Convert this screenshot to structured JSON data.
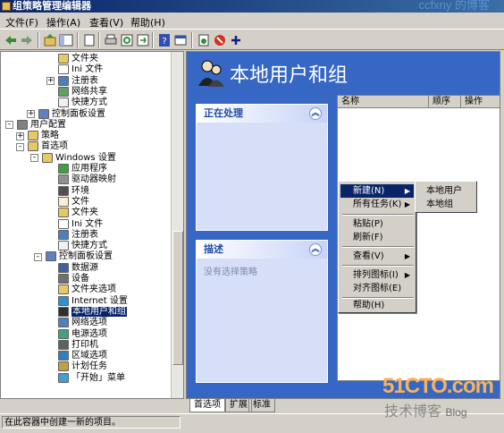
{
  "window": {
    "title": "组策略管理编辑器",
    "watermark_top": "ccfxny 的博客"
  },
  "menubar": {
    "items": [
      "文件(F)",
      "操作(A)",
      "查看(V)",
      "帮助(H)"
    ]
  },
  "toolbar": {
    "icons": [
      "back-icon",
      "forward-icon",
      "up-icon",
      "show-hide-tree-icon",
      "copy-icon",
      "print-icon",
      "refresh-icon",
      "export-icon",
      "help-icon",
      "properties-icon",
      "new-item-icon",
      "stop-icon",
      "add-icon"
    ]
  },
  "tree": {
    "rows": [
      {
        "label": "文件夹",
        "icon": "folder"
      },
      {
        "label": "Ini 文件",
        "icon": "ini"
      },
      {
        "label": "注册表",
        "icon": "registry",
        "expander": "+"
      },
      {
        "label": "网络共享",
        "icon": "share"
      },
      {
        "label": "快捷方式",
        "icon": "shortcut"
      },
      {
        "label": "控制面板设置",
        "icon": "control-panel",
        "expander": "+"
      },
      {
        "label": "用户配置",
        "icon": "user",
        "expander": "-"
      },
      {
        "label": "策略",
        "icon": "folder",
        "expander": "+"
      },
      {
        "label": "首选项",
        "icon": "folder",
        "expander": "-"
      },
      {
        "label": "Windows 设置",
        "icon": "folder",
        "expander": "-"
      },
      {
        "label": "应用程序",
        "icon": "app"
      },
      {
        "label": "驱动器映射",
        "icon": "drive"
      },
      {
        "label": "环境",
        "icon": "env"
      },
      {
        "label": "文件",
        "icon": "file"
      },
      {
        "label": "文件夹",
        "icon": "folder"
      },
      {
        "label": "Ini 文件",
        "icon": "ini"
      },
      {
        "label": "注册表",
        "icon": "registry"
      },
      {
        "label": "快捷方式",
        "icon": "shortcut"
      },
      {
        "label": "控制面板设置",
        "icon": "control-panel",
        "expander": "-"
      },
      {
        "label": "数据源",
        "icon": "datasource"
      },
      {
        "label": "设备",
        "icon": "device"
      },
      {
        "label": "文件夹选项",
        "icon": "folder-options"
      },
      {
        "label": "Internet 设置",
        "icon": "internet"
      },
      {
        "label": "本地用户和组",
        "icon": "users",
        "selected": true
      },
      {
        "label": "网络选项",
        "icon": "network"
      },
      {
        "label": "电源选项",
        "icon": "power"
      },
      {
        "label": "打印机",
        "icon": "printer"
      },
      {
        "label": "区域选项",
        "icon": "region"
      },
      {
        "label": "计划任务",
        "icon": "task"
      },
      {
        "label": "「开始」菜单",
        "icon": "start-menu"
      }
    ]
  },
  "right": {
    "title": "本地用户和组",
    "panel_processing": {
      "heading": "正在处理"
    },
    "panel_description": {
      "heading": "描述",
      "body": "没有选择策略"
    },
    "columns": [
      "名称",
      "顺序",
      "操作"
    ]
  },
  "context_menu": {
    "items": [
      {
        "label": "新建(N)",
        "arrow": true,
        "active": true
      },
      {
        "label": "所有任务(K)",
        "arrow": true
      },
      {
        "label": "粘贴(P)"
      },
      {
        "label": "刷新(F)"
      },
      {
        "label": "查看(V)",
        "arrow": true
      },
      {
        "label": "排列图标(I)",
        "arrow": true
      },
      {
        "label": "对齐图标(E)"
      },
      {
        "label": "帮助(H)"
      }
    ],
    "submenu": [
      "本地用户",
      "本地组"
    ]
  },
  "tabs": [
    "首选项",
    "扩展",
    "标准"
  ],
  "statusbar": {
    "text": "在此容器中创建一新的项目。"
  },
  "watermark": {
    "logo": "51CTO.com",
    "sub_cn": "技术博客",
    "sub_en": "Blog"
  },
  "colors": {
    "title_bar": "#0a246a",
    "right_pane_bg": "#3667c5",
    "panel_bg": "#d6dff7",
    "selection": "#0a246a"
  }
}
